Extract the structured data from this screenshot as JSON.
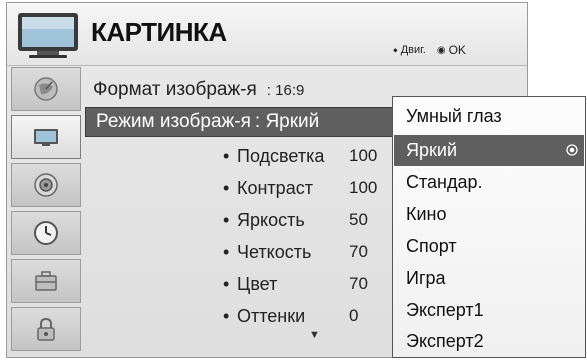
{
  "header": {
    "title": "КАРТИНКА",
    "move_label": "Двиг.",
    "ok_label": "OK",
    "move_icon": "four-way-arrow-icon",
    "ok_icon": "ok-circle-icon"
  },
  "sidebar": {
    "items": [
      {
        "name": "satellite-dish-icon",
        "active": false
      },
      {
        "name": "tv-screen-icon",
        "active": true
      },
      {
        "name": "speaker-icon",
        "active": false
      },
      {
        "name": "clock-icon",
        "active": false
      },
      {
        "name": "toolbox-icon",
        "active": false
      },
      {
        "name": "padlock-icon",
        "active": false
      }
    ]
  },
  "menu": {
    "aspect": {
      "label": "Формат изображ-я",
      "value": ": 16:9"
    },
    "picture_mode": {
      "label": "Режим изображ-я",
      "value": ": Яркий"
    },
    "settings": [
      {
        "label": "Подсветка",
        "value": "100"
      },
      {
        "label": "Контраст",
        "value": "100"
      },
      {
        "label": "Яркость",
        "value": "50"
      },
      {
        "label": "Четкость",
        "value": "70"
      },
      {
        "label": "Цвет",
        "value": "70"
      },
      {
        "label": "Оттенки",
        "value": "0"
      }
    ],
    "bullet": "•",
    "scroll_down": "▼"
  },
  "dropdown": {
    "options": [
      "Умный глаз",
      "Яркий",
      "Стандар.",
      "Кино",
      "Спорт",
      "Игра",
      "Эксперт1",
      "Эксперт2"
    ],
    "selected_index": 1
  },
  "colors": {
    "selection_bg": "#5f5f5f",
    "selection_text": "#ffffff",
    "panel_bg": "#e4e4e4"
  }
}
